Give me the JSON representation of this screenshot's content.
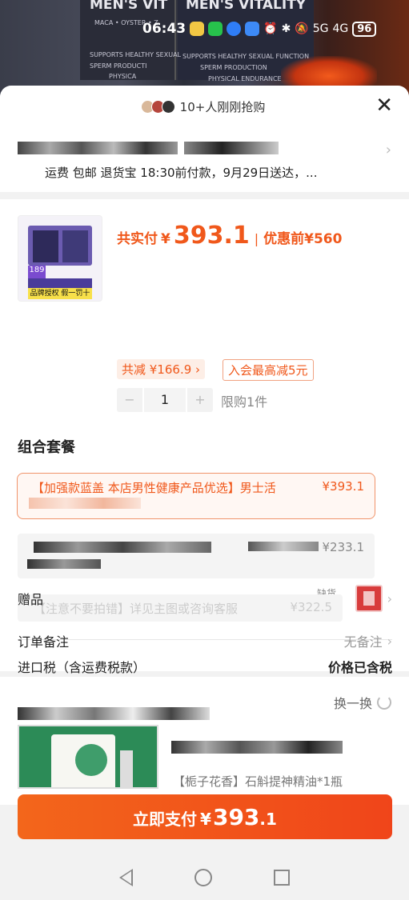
{
  "status_bar": {
    "time": "06:43",
    "network": "5G",
    "network2": "4G",
    "battery": "96"
  },
  "background": {
    "left_title": "MEN'S VIT",
    "right_title": "MEN'S VITALITY",
    "left_sub": "MACA • OYSTER • Z",
    "left_line1": "SUPPORTS HEALTHY SEXUAL",
    "left_line2": "SPERM PRODUCTI",
    "left_line3": "PHYSICA",
    "right_line1": "SUPPORTS HEALTHY SEXUAL FUNCTION",
    "right_line2": "SPERM PRODUCTION",
    "right_line3": "PHYSICAL ENDURANCE"
  },
  "header": {
    "buyers_text": "10+人刚刚抢购",
    "close_label": "✕"
  },
  "shipping": {
    "text": "运费 包邮 退货宝 18:30前付款，9月29日送达，..."
  },
  "product": {
    "thumb_badge": "189",
    "thumb_banner": "品牌授权 假一罚十",
    "total_label": "共实付",
    "currency": "¥",
    "total_price": "393.1",
    "before_label": "优惠前",
    "before_price": "¥560",
    "discount_chip": "共减 ¥166.9",
    "member_chip": "入会最高减5元",
    "quantity": "1",
    "minus": "−",
    "plus": "+",
    "limit": "限购1件"
  },
  "combo": {
    "title": "组合套餐",
    "selected_name": "【加强款蓝盖 本店男性健康产品优选】男士活",
    "selected_price": "¥393.1",
    "option2_price": "¥233.1",
    "option3_name": "【注意不要拍错】详见主图或咨询客服",
    "option3_price": "¥322.5",
    "out_of_stock": "缺货"
  },
  "rows": {
    "tax_label": "进口税（含运费税款）",
    "tax_value": "价格已含税",
    "gift_label": "赠品",
    "remark_label": "订单备注",
    "remark_value": "无备注"
  },
  "recommend": {
    "swap_label": "换一换",
    "desc": "【栀子花香】石斛提神精油*1瓶"
  },
  "pay": {
    "label": "立即支付",
    "currency": "¥",
    "int": "393",
    "dec": ".1"
  }
}
